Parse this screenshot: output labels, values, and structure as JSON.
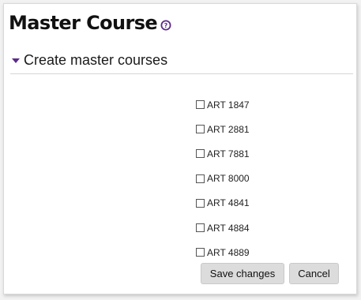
{
  "page": {
    "title": "Master Course",
    "help_icon": "question-circle"
  },
  "section": {
    "title": "Create master courses",
    "expanded": true
  },
  "courses": [
    {
      "label": "ART 1847",
      "checked": false
    },
    {
      "label": "ART 2881",
      "checked": false
    },
    {
      "label": "ART 7881",
      "checked": false
    },
    {
      "label": "ART 8000",
      "checked": false
    },
    {
      "label": "ART 4841",
      "checked": false
    },
    {
      "label": "ART 4884",
      "checked": false
    },
    {
      "label": "ART 4889",
      "checked": false
    }
  ],
  "actions": {
    "save_label": "Save changes",
    "cancel_label": "Cancel"
  },
  "colors": {
    "accent": "#5b2c86",
    "button_bg": "#dcdcdc"
  }
}
